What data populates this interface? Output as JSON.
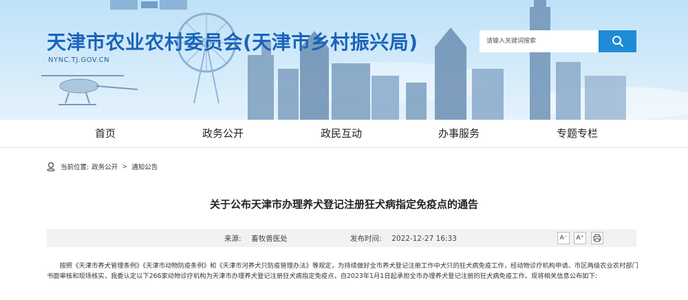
{
  "header": {
    "title": "天津市农业农村委员会(天津市乡村振兴局)",
    "domain": "NYNC.TJ.GOV.CN",
    "search_placeholder": "请输入关键词搜索"
  },
  "nav": {
    "items": [
      {
        "label": "首页"
      },
      {
        "label": "政务公开"
      },
      {
        "label": "政民互动"
      },
      {
        "label": "办事服务"
      },
      {
        "label": "专题专栏"
      }
    ]
  },
  "breadcrumb": {
    "prefix": "当前位置:",
    "items": [
      "政务公开",
      "通知公告"
    ],
    "separator": ">"
  },
  "article": {
    "title": "关于公布天津市办理养犬登记注册狂犬病指定免疫点的通告",
    "source_label": "来源:",
    "source": "畜牧兽医处",
    "date_label": "发布时间:",
    "date": "2022-12-27 16:33",
    "font_up": "A⁻",
    "font_down": "A⁺",
    "body": "按照《天津市养犬管理条例》《天津市动物防疫条例》和《天津市河养犬只防疫管理办法》等规定，为持续做好全市养犬登记注册工作中犬只的狂犬病免疫工作，经动物诊疗机构申请、市区两级农业农村部门书面审核和现场核实，我委认定以下266家动物诊疗机构为天津市办理养犬登记注册狂犬病指定免疫点，自2023年1月1日起承担全市办理养犬登记注册的狂犬病免疫工作。现将相关信息公布如下:"
  },
  "colors": {
    "brand_blue": "#1b63b8",
    "search_button": "#1f8bd6",
    "meta_bg": "#f2f2f2"
  },
  "icons": [
    "search-icon",
    "location-pin-icon",
    "print-icon"
  ]
}
